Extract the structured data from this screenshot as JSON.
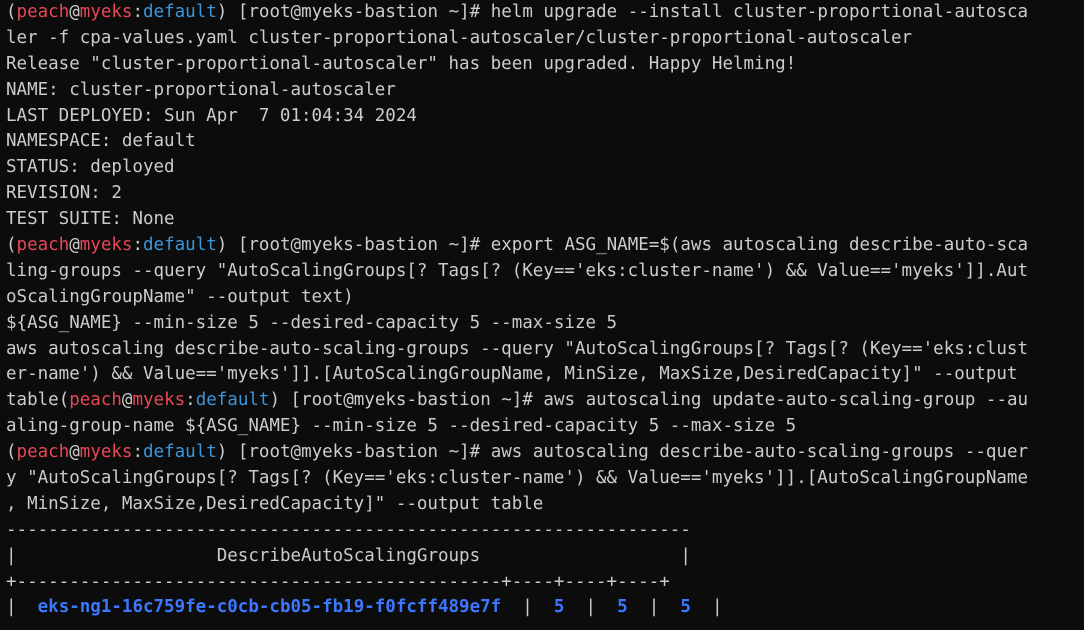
{
  "prompt": {
    "open": "(",
    "user": "peach",
    "at": "@",
    "host": "myeks",
    "colon": ":",
    "namespace": "default",
    "close": ")",
    "shell": " [root@myeks-bastion ~]# "
  },
  "lines": {
    "l1": "helm upgrade --install cluster-proportional-autosca",
    "l2": "ler -f cpa-values.yaml cluster-proportional-autoscaler/cluster-proportional-autoscaler",
    "l3": "Release \"cluster-proportional-autoscaler\" has been upgraded. Happy Helming!",
    "l4": "NAME: cluster-proportional-autoscaler",
    "l5": "LAST DEPLOYED: Sun Apr  7 01:04:34 2024",
    "l6": "NAMESPACE: default",
    "l7": "STATUS: deployed",
    "l8": "REVISION: 2",
    "l9": "TEST SUITE: None",
    "l10": "export ASG_NAME=$(aws autoscaling describe-auto-sca",
    "l11": "ling-groups --query \"AutoScalingGroups[? Tags[? (Key=='eks:cluster-name') && Value=='myeks']].Aut",
    "l12": "oScalingGroupName\" --output text)",
    "l13": "${ASG_NAME} --min-size 5 --desired-capacity 5 --max-size 5",
    "l14": "aws autoscaling describe-auto-scaling-groups --query \"AutoScalingGroups[? Tags[? (Key=='eks:clust",
    "l15": "er-name') && Value=='myeks']].[AutoScalingGroupName, MinSize, MaxSize,DesiredCapacity]\" --output",
    "l16_pre": "table",
    "l16": "aws autoscaling update-auto-scaling-group --au",
    "l17": "aling-group-name ${ASG_NAME} --min-size 5 --desired-capacity 5 --max-size 5",
    "l18": "aws autoscaling describe-auto-scaling-groups --quer",
    "l19": "y \"AutoScalingGroups[? Tags[? (Key=='eks:cluster-name') && Value=='myeks']].[AutoScalingGroupName",
    "l20": ", MinSize, MaxSize,DesiredCapacity]\" --output table"
  },
  "table": {
    "top_border": "-----------------------------------------------------------------",
    "title_row_left": "|",
    "title": "                   DescribeAutoScalingGroups                   ",
    "title_row_right": "|",
    "separator": "+----------------------------------------------+----+----+----+",
    "row_pipe": "|",
    "row_pad": "  ",
    "group_name": "eks-ng1-16c759fe-c0cb-cb05-fb19-f0fcff489e7f",
    "min_size": "5",
    "max_size": "5",
    "desired": "5"
  }
}
